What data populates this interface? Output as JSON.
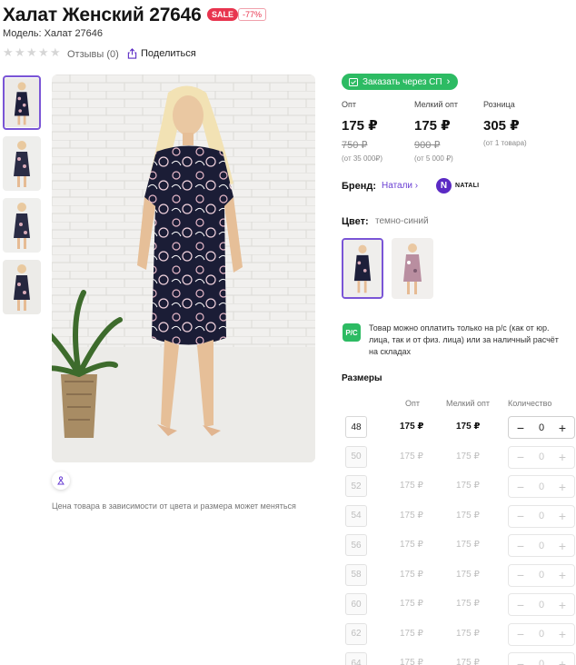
{
  "product": {
    "title": "Халат Женский 27646",
    "sale_badge": "SALE",
    "discount_badge": "-77%",
    "model_text": "Модель: Халат 27646"
  },
  "rating": {
    "stars_filled": 0,
    "stars_total": 5,
    "reviews_label": "Отзывы (0)",
    "share_label": "Поделиться"
  },
  "gallery": {
    "thumbnail_count": 4,
    "active_index": 0,
    "price_note": "Цена товара в зависимости от цвета и размера может меняться"
  },
  "order_button": {
    "label": "Заказать через СП"
  },
  "prices": [
    {
      "label": "Опт",
      "current": "175 ₽",
      "old": "750 ₽",
      "condition": "(от 35 000₽)"
    },
    {
      "label": "Мелкий опт",
      "current": "175 ₽",
      "old": "900 ₽",
      "condition": "(от 5 000 ₽)"
    },
    {
      "label": "Розница",
      "current": "305 ₽",
      "old": "",
      "condition": "(от 1 товара)"
    }
  ],
  "brand": {
    "label": "Бренд:",
    "link": "Натали",
    "logo_letter": "N",
    "logo_text": "NATALI"
  },
  "color": {
    "label": "Цвет:",
    "value": "темно-синий",
    "active_index": 0
  },
  "payment_note": {
    "icon_text": "Р/С",
    "text": "Товар можно оплатить только на р/с (как от юр. лица, так и от физ. лица) или за наличный расчёт на складах"
  },
  "sizes": {
    "title": "Размеры",
    "headers": {
      "opt": "Опт",
      "small_opt": "Мелкий опт",
      "quantity": "Количество"
    },
    "rows": [
      {
        "size": "48",
        "opt": "175 ₽",
        "small_opt": "175 ₽",
        "qty": "0",
        "available": true
      },
      {
        "size": "50",
        "opt": "175 ₽",
        "small_opt": "175 ₽",
        "qty": "0",
        "available": false
      },
      {
        "size": "52",
        "opt": "175 ₽",
        "small_opt": "175 ₽",
        "qty": "0",
        "available": false
      },
      {
        "size": "54",
        "opt": "175 ₽",
        "small_opt": "175 ₽",
        "qty": "0",
        "available": false
      },
      {
        "size": "56",
        "opt": "175 ₽",
        "small_opt": "175 ₽",
        "qty": "0",
        "available": false
      },
      {
        "size": "58",
        "opt": "175 ₽",
        "small_opt": "175 ₽",
        "qty": "0",
        "available": false
      },
      {
        "size": "60",
        "opt": "175 ₽",
        "small_opt": "175 ₽",
        "qty": "0",
        "available": false
      },
      {
        "size": "62",
        "opt": "175 ₽",
        "small_opt": "175 ₽",
        "qty": "0",
        "available": false
      },
      {
        "size": "64",
        "opt": "175 ₽",
        "small_opt": "175 ₽",
        "qty": "0",
        "available": false
      }
    ]
  },
  "colors": {
    "accent": "#7a55d6",
    "green": "#2dbb63",
    "sale": "#e8344e",
    "dress": "#1d1f3a"
  }
}
